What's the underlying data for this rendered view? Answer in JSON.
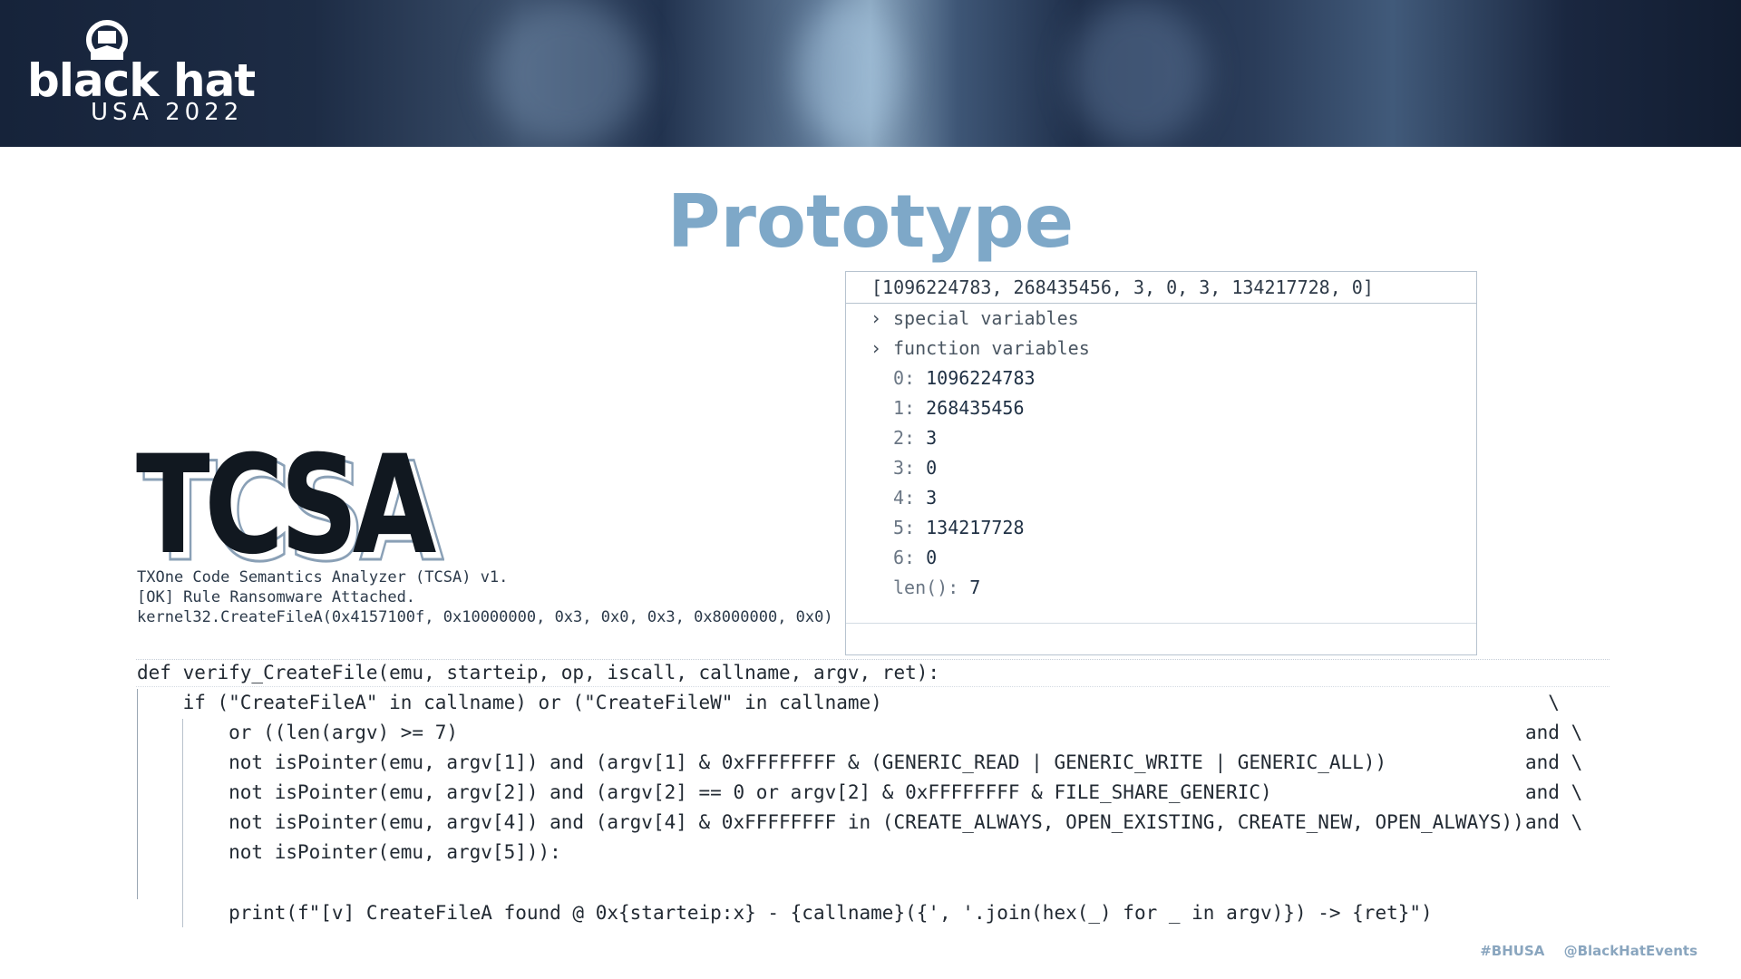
{
  "header": {
    "logo_word": "black hat",
    "logo_sub": "USA 2022"
  },
  "slide": {
    "title": "Prototype"
  },
  "debugger": {
    "header_value": "[1096224783, 268435456, 3, 0, 3, 134217728, 0]",
    "groups": [
      "special variables",
      "function variables"
    ],
    "items": [
      {
        "key": "0:",
        "value": "1096224783"
      },
      {
        "key": "1:",
        "value": "268435456"
      },
      {
        "key": "2:",
        "value": "3"
      },
      {
        "key": "3:",
        "value": "0"
      },
      {
        "key": "4:",
        "value": "3"
      },
      {
        "key": "5:",
        "value": "134217728"
      },
      {
        "key": "6:",
        "value": "0"
      },
      {
        "key": "len():",
        "value": "7"
      }
    ]
  },
  "tcsa": {
    "logo_text": "TCSA",
    "console_lines": [
      "TXOne Code Semantics Analyzer (TCSA) v1.",
      "[OK] Rule Ransomware Attached.",
      "kernel32.CreateFileA(0x4157100f, 0x10000000, 0x3, 0x0, 0x3, 0x8000000, 0x0)"
    ]
  },
  "code": {
    "line1": "def verify_CreateFile(emu, starteip, op, iscall, callname, argv, ret):",
    "line2": "    if (\"CreateFileA\" in callname) or (\"CreateFileW\" in callname)",
    "line3": "        or ((len(argv) >= 7)",
    "line4": "        not isPointer(emu, argv[1]) and (argv[1] & 0xFFFFFFFF & (GENERIC_READ | GENERIC_WRITE | GENERIC_ALL))",
    "line5": "        not isPointer(emu, argv[2]) and (argv[2] == 0 or argv[2] & 0xFFFFFFFF & FILE_SHARE_GENERIC)",
    "line6": "        not isPointer(emu, argv[4]) and (argv[4] & 0xFFFFFFFF in (CREATE_ALWAYS, OPEN_EXISTING, CREATE_NEW, OPEN_ALWAYS))",
    "line7": "        not isPointer(emu, argv[5])):",
    "line8": "        print(f\"[v] CreateFileA found @ 0x{starteip:x} - {callname}({', '.join(hex(_) for _ in argv)}) -> {ret}\")",
    "trail2": "  \\",
    "trail3": "and \\",
    "trail4": "and \\",
    "trail5": "and \\",
    "trail6": "and \\"
  },
  "footer": {
    "hashtag": "#BHUSA",
    "handle": "@BlackHatEvents"
  }
}
